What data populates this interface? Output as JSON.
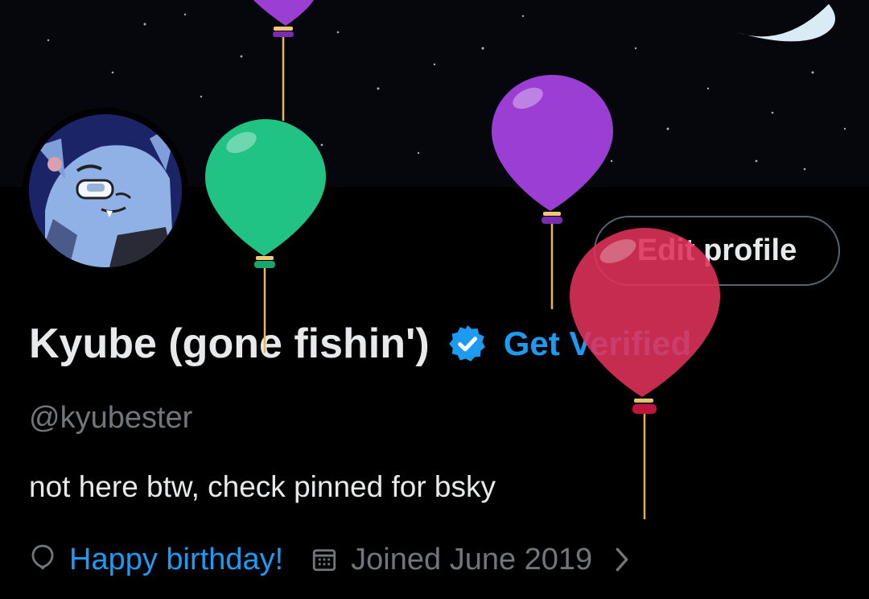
{
  "profile": {
    "display_name": "Kyube (gone fishin')",
    "handle": "@kyubester",
    "bio": "not here btw, check pinned for bsky",
    "get_verified_label": "Get Verified",
    "edit_profile_label": "Edit profile",
    "birthday_label": "Happy birthday!",
    "joined_label": "Joined June 2019"
  },
  "icons": {
    "verified": "verified-badge-icon",
    "birthday": "balloon-icon",
    "calendar": "calendar-icon",
    "more": "chevron-right-icon"
  },
  "colors": {
    "background": "#000000",
    "text_primary": "#e7e9ea",
    "text_secondary": "#71767b",
    "accent": "#1d9bf0",
    "balloon_green": "#20c384",
    "balloon_purple": "#9b3fd4",
    "balloon_red": "#e0325a"
  }
}
